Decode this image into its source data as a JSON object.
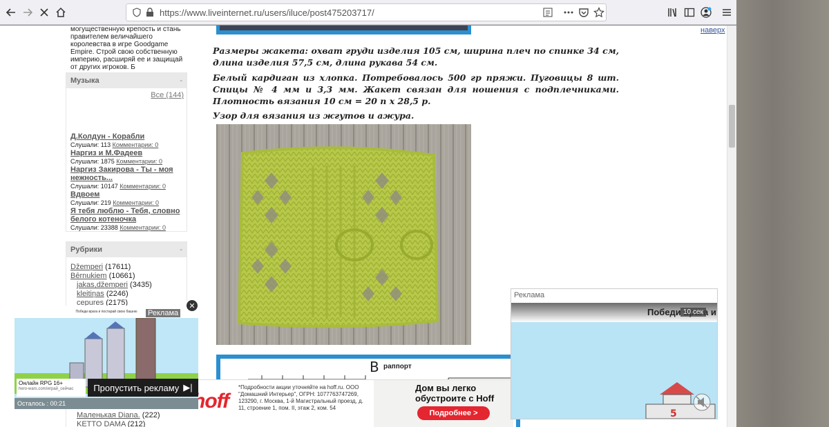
{
  "browser": {
    "url": "https://www.liveinternet.ru/users/iluce/post475203717/"
  },
  "sidebar": {
    "intro": "могущественную крепость и стань правителем величайшего королевства в игре Goodgame Empire. Строй свою собственную империю, расширяй ее и защищай от других игроков. Б",
    "music": {
      "title": "Музыка",
      "minimize": "-",
      "all_link": "Все (144)",
      "tracks": [
        {
          "title": "Д.Колдун - Корабли",
          "listens": "Слушали: 113",
          "comments": "Комментарии: 0"
        },
        {
          "title": "Наргиз и М.Фадеев",
          "listens": "Слушали: 1875",
          "comments": "Комментарии: 0"
        },
        {
          "title": "Наргиз Закирова - Ты - моя нежность...",
          "listens": "Слушали: 10147",
          "comments": "Комментарии: 0"
        },
        {
          "title": "Вдвоем",
          "listens": "Слушали: 219",
          "comments": "Комментарии: 0"
        },
        {
          "title": "Я тебя люблю - Тебя, словно белого котеночка",
          "listens": "Слушали: 23388",
          "comments": "Комментарии: 0"
        }
      ]
    },
    "rubrics": {
      "title": "Рубрики",
      "minimize": "-",
      "items": [
        {
          "name": "Džemperi",
          "count": "(17611)"
        },
        {
          "name": "Bērnukiem",
          "count": "(10661)"
        },
        {
          "name": "jakas,džemperi",
          "count": "(3435)"
        },
        {
          "name": "kleitiņas",
          "count": "(2246)"
        },
        {
          "name": "cepures",
          "count": "(2175)"
        }
      ],
      "tail_items": [
        {
          "name": "Маленькая Diana.",
          "count": "(222)"
        },
        {
          "name": "KETTO DAMA",
          "count": "(212)"
        }
      ]
    }
  },
  "article": {
    "vverh": "наверх",
    "para1": "Размеры жакета: охват груди изделия 105 см, ширина плеч по спинке 34 см, длина изделия 57,5 см, длина рукава 54 см.",
    "para2": "Белый кардиган из хлопка. Потребовалось 500 гр пряжи. Пуговицы 8 шт. Спицы № 4 мм и 3,3 мм. Жакет связан для ношения с подплечниками. Плотность вязания 10 см = 20 п х 28,5 р.",
    "para3": "Узор для вязания из жгутов и ажура.",
    "chart_heading": "раппорт",
    "chart_letter": "B"
  },
  "ad_left": {
    "label": "Реклама",
    "game_caption": "Победи врага и постарай свою башню",
    "rating": "Онлайн RPG 16+",
    "domain": "hero-wars.com/играй_сейчас",
    "remaining": "Осталось : 00:21",
    "skip": "Пропустить рекламу",
    "close": "✕"
  },
  "ad_hoff": {
    "logo": "hoff",
    "fine_print": "*Подробности акции уточняйте на hoff.ru. ООО \"Домашний Интерьер\", ОГРН: 1077763747269, 123290, г. Москва, 1-й Магистральный проезд, д. 11, строение 1, пом. II, этаж 2, ком. 54",
    "headline": "Дом вы легко обустроите с Hoff",
    "cta": "Подробнее >"
  },
  "ad_right": {
    "label": "Реклама",
    "timer": "10 сек",
    "banner_text": "Победи врага и"
  },
  "colors": {
    "knit_green": "#b8c94a",
    "wood": "#a9a49a",
    "hoff_red": "#e3262f",
    "sky": "#b8e4f6"
  }
}
